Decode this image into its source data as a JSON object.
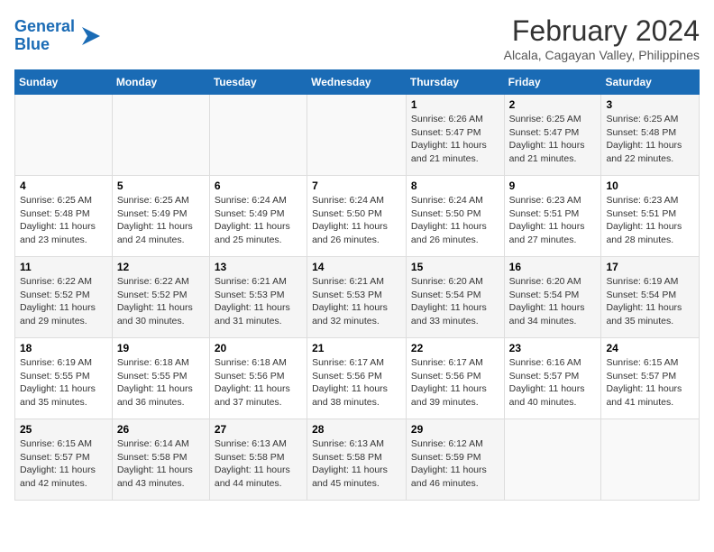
{
  "header": {
    "logo_line1": "General",
    "logo_line2": "Blue",
    "month_year": "February 2024",
    "location": "Alcala, Cagayan Valley, Philippines"
  },
  "days_of_week": [
    "Sunday",
    "Monday",
    "Tuesday",
    "Wednesday",
    "Thursday",
    "Friday",
    "Saturday"
  ],
  "weeks": [
    [
      {
        "day": "",
        "content": ""
      },
      {
        "day": "",
        "content": ""
      },
      {
        "day": "",
        "content": ""
      },
      {
        "day": "",
        "content": ""
      },
      {
        "day": "1",
        "content": "Sunrise: 6:26 AM\nSunset: 5:47 PM\nDaylight: 11 hours and 21 minutes."
      },
      {
        "day": "2",
        "content": "Sunrise: 6:25 AM\nSunset: 5:47 PM\nDaylight: 11 hours and 21 minutes."
      },
      {
        "day": "3",
        "content": "Sunrise: 6:25 AM\nSunset: 5:48 PM\nDaylight: 11 hours and 22 minutes."
      }
    ],
    [
      {
        "day": "4",
        "content": "Sunrise: 6:25 AM\nSunset: 5:48 PM\nDaylight: 11 hours and 23 minutes."
      },
      {
        "day": "5",
        "content": "Sunrise: 6:25 AM\nSunset: 5:49 PM\nDaylight: 11 hours and 24 minutes."
      },
      {
        "day": "6",
        "content": "Sunrise: 6:24 AM\nSunset: 5:49 PM\nDaylight: 11 hours and 25 minutes."
      },
      {
        "day": "7",
        "content": "Sunrise: 6:24 AM\nSunset: 5:50 PM\nDaylight: 11 hours and 26 minutes."
      },
      {
        "day": "8",
        "content": "Sunrise: 6:24 AM\nSunset: 5:50 PM\nDaylight: 11 hours and 26 minutes."
      },
      {
        "day": "9",
        "content": "Sunrise: 6:23 AM\nSunset: 5:51 PM\nDaylight: 11 hours and 27 minutes."
      },
      {
        "day": "10",
        "content": "Sunrise: 6:23 AM\nSunset: 5:51 PM\nDaylight: 11 hours and 28 minutes."
      }
    ],
    [
      {
        "day": "11",
        "content": "Sunrise: 6:22 AM\nSunset: 5:52 PM\nDaylight: 11 hours and 29 minutes."
      },
      {
        "day": "12",
        "content": "Sunrise: 6:22 AM\nSunset: 5:52 PM\nDaylight: 11 hours and 30 minutes."
      },
      {
        "day": "13",
        "content": "Sunrise: 6:21 AM\nSunset: 5:53 PM\nDaylight: 11 hours and 31 minutes."
      },
      {
        "day": "14",
        "content": "Sunrise: 6:21 AM\nSunset: 5:53 PM\nDaylight: 11 hours and 32 minutes."
      },
      {
        "day": "15",
        "content": "Sunrise: 6:20 AM\nSunset: 5:54 PM\nDaylight: 11 hours and 33 minutes."
      },
      {
        "day": "16",
        "content": "Sunrise: 6:20 AM\nSunset: 5:54 PM\nDaylight: 11 hours and 34 minutes."
      },
      {
        "day": "17",
        "content": "Sunrise: 6:19 AM\nSunset: 5:54 PM\nDaylight: 11 hours and 35 minutes."
      }
    ],
    [
      {
        "day": "18",
        "content": "Sunrise: 6:19 AM\nSunset: 5:55 PM\nDaylight: 11 hours and 35 minutes."
      },
      {
        "day": "19",
        "content": "Sunrise: 6:18 AM\nSunset: 5:55 PM\nDaylight: 11 hours and 36 minutes."
      },
      {
        "day": "20",
        "content": "Sunrise: 6:18 AM\nSunset: 5:56 PM\nDaylight: 11 hours and 37 minutes."
      },
      {
        "day": "21",
        "content": "Sunrise: 6:17 AM\nSunset: 5:56 PM\nDaylight: 11 hours and 38 minutes."
      },
      {
        "day": "22",
        "content": "Sunrise: 6:17 AM\nSunset: 5:56 PM\nDaylight: 11 hours and 39 minutes."
      },
      {
        "day": "23",
        "content": "Sunrise: 6:16 AM\nSunset: 5:57 PM\nDaylight: 11 hours and 40 minutes."
      },
      {
        "day": "24",
        "content": "Sunrise: 6:15 AM\nSunset: 5:57 PM\nDaylight: 11 hours and 41 minutes."
      }
    ],
    [
      {
        "day": "25",
        "content": "Sunrise: 6:15 AM\nSunset: 5:57 PM\nDaylight: 11 hours and 42 minutes."
      },
      {
        "day": "26",
        "content": "Sunrise: 6:14 AM\nSunset: 5:58 PM\nDaylight: 11 hours and 43 minutes."
      },
      {
        "day": "27",
        "content": "Sunrise: 6:13 AM\nSunset: 5:58 PM\nDaylight: 11 hours and 44 minutes."
      },
      {
        "day": "28",
        "content": "Sunrise: 6:13 AM\nSunset: 5:58 PM\nDaylight: 11 hours and 45 minutes."
      },
      {
        "day": "29",
        "content": "Sunrise: 6:12 AM\nSunset: 5:59 PM\nDaylight: 11 hours and 46 minutes."
      },
      {
        "day": "",
        "content": ""
      },
      {
        "day": "",
        "content": ""
      }
    ]
  ]
}
